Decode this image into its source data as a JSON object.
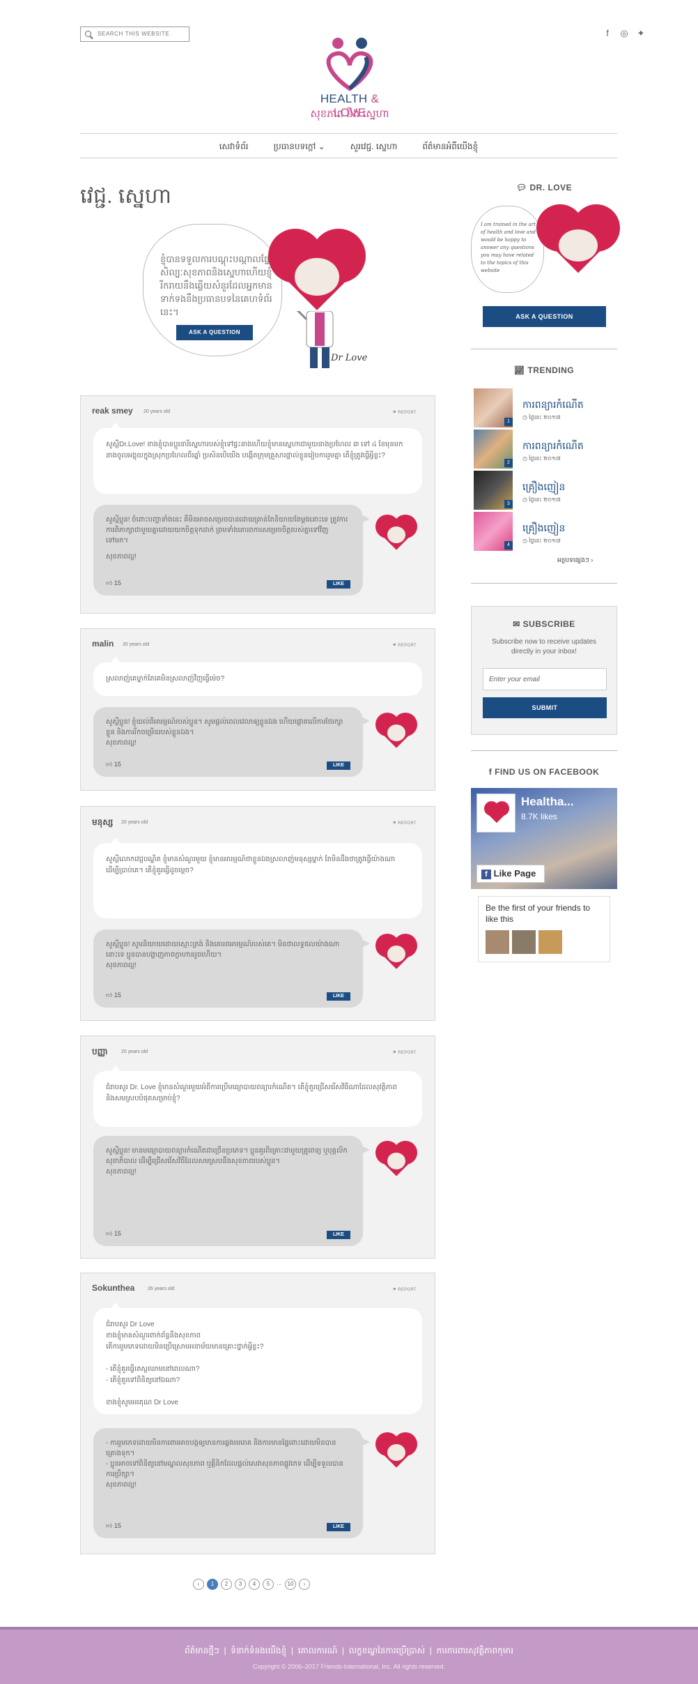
{
  "header": {
    "search_placeholder": "SEARCH THIS WEBSITE",
    "logo_title_a": "HEALTH",
    "logo_amp": "&",
    "logo_title_b": "LOVE",
    "logo_sub": "សុខភាព និង ស្នេហា",
    "social": [
      "facebook-icon",
      "instagram-icon",
      "twitter-icon"
    ]
  },
  "nav": {
    "items": [
      "សេវាទំព័រ",
      "ប្រធានបទក្តៅ",
      "សួរវេជ្ជ. ស្នេហា",
      "ព័ត៌មានអំពីយើងខ្ញុំ"
    ]
  },
  "page": {
    "title": "វេជ្ជ. ស្នេហា",
    "hero_text": "ខ្ញុំបានទទួលការបណ្តុះបណ្តាលផ្នែកសិល្បៈសុខភាពនិងស្នេហាហើយខ្ញុំរីករាយនឹងឆ្លើយសំនួរដែលអ្នកមានទាក់ទងនឹងប្រធានបទនៃគេហទំព័រនេះ។",
    "ask_label": "ASK A QUESTION",
    "signature": "Dr Love"
  },
  "questions": [
    {
      "name": "reak smey",
      "age": "20 years old",
      "report": "REPORT",
      "question": "សួស្តីDr.Love! ខាងខ្ញុំបានប្តូរនារីស្នេហារបស់ខ្ញុំទៅផ្ទះនាងហើយ​ខ្ញុំមានស្នេហាជាមួយនាងប្រហែល ៣ ទៅ ៤ ខែមុនមក នាងចូលអង្គុយក្នុងស្រុកប្រហែលពីរឆ្នាំ ប្រសិនបើយើង បង្កើតក្រុមគ្រួសារផ្ទាល់ខ្លួនរៀបការរួមគ្នា តើខ្ញុំត្រូវធ្វើអ្វីខ្លះ?",
      "answer": "សួស្តីប្អូន! ចំពោះបញ្ហាទាំងនេះ គឺមិនអាចសម្រេចបានដោយគ្រាន់តែនិយាយតែម្តងនោះទេ ត្រូវការការពិភាក្សាជាមួយគ្នាដោយយកចិត្តទុកដាក់ ព្រមទាំងគោរពការសម្រេចចិត្តរបស់គ្នាទៅវិញទៅមក។",
      "signoff": "សុខភាពល្អ!",
      "likes": "15"
    },
    {
      "name": "malin",
      "age": "20 years old",
      "report": "REPORT",
      "question": "ស្រលាញ់គេម្នាក់តែគេមិនស្រលាញ់វិញធ្វើម៉េច?",
      "answer": "សួស្តីប្អូន! ខ្ញុំយល់ពីអារម្មណ៍របស់ប្អូន។ សូមផ្តល់ពេលវេលាឲ្យខ្លួនឯង ហើយផ្តោតលើការថែរក្សាខ្លួន និងការរីកចម្រើនរបស់ខ្លួនឯង។",
      "signoff": "សុខភាពល្អ!",
      "likes": "15"
    },
    {
      "name": "មនុស្ស",
      "age": "20 years old",
      "report": "REPORT",
      "question": "សួស្តីលោកវេជ្ជបណ្ឌិត ខ្ញុំមានសំណួរមួយ ខ្ញុំមានអារម្មណ៍ថាខ្លួនឯងស្រលាញ់មនុស្សម្នាក់ តែមិនដឹងថាត្រូវធ្វើយ៉ាងណា ដើម្បីប្រាប់គេ។ តើខ្ញុំគួរធ្វើដូចម្តេច?",
      "answer": "សួស្តីប្អូន! សូមនិយាយដោយស្មោះត្រង់ និងគោរពអារម្មណ៍របស់គេ។ មិនថាលទ្ធផលយ៉ាងណានោះទេ ប្អូនបានបង្ហាញភាពក្លាហានរួចហើយ។",
      "signoff": "សុខភាពល្អ!",
      "likes": "15"
    },
    {
      "name": "បញ្ញា",
      "age": "20 years old",
      "report": "REPORT",
      "question": "ជំរាបសួរ Dr. Love ខ្ញុំមានសំណួរមួយអំពីការប្រើមធ្យោបាយពន្យារកំណើត។ តើខ្ញុំគួរជ្រើសរើសវិធីណាដែលសុវត្ថិភាព និងសមស្របបំផុតសម្រាប់ខ្ញុំ?",
      "answer": "សួស្តីប្អូន! មានមធ្យោបាយពន្យារកំណើតជាច្រើនប្រភេទ។ ប្អូនគួរពិគ្រោះជាមួយគ្រូពេទ្យ ឬបុគ្គលិកសុខាភិបាល ដើម្បីជ្រើសរើសវិធីដែលសមស្របនឹងសុខភាពរបស់ប្អូន។",
      "signoff": "សុខភាពល្អ!",
      "likes": "15"
    },
    {
      "name": "Sokunthea",
      "age": "26 years old",
      "report": "REPORT",
      "question": "ជំរាបសួរ Dr Love\nខាងខ្ញុំមានសំណួរពាក់ព័ន្ធនឹងសុខភាព\nតើការរួមភេទដោយមិនប្រើស្រោមអនាម័យមានគ្រោះថ្នាក់អ្វីខ្លះ?\n\n- តើខ្ញុំគួរធ្វើតេស្តឈាមនៅពេលណា?\n- តើខ្ញុំគួរទៅពិនិត្យនៅឯណា?\n\nខាងខ្ញុំសូមអរគុណ Dr Love",
      "answer": "- ការរួមភេទដោយមិនការពារអាចបង្កឲ្យមានការឆ្លងមេរោគ និងការមានផ្ទៃពោះដោយមិនបានគ្រោងទុក។\n- ប្អូនអាចទៅពិនិត្យនៅមណ្ឌលសុខភាព ឬគ្លីនិកដែលផ្តល់សេវាសុខភាពផ្លូវភេទ ដើម្បីទទួលបានការប្រឹក្សា។",
      "signoff": "សុខភាពល្អ!",
      "likes": "15"
    }
  ],
  "pagination": {
    "pages": [
      "1",
      "2",
      "3",
      "4",
      "5",
      "...",
      "10"
    ],
    "current": "1",
    "prev": "‹",
    "next": "›"
  },
  "sidebar": {
    "drlove_heading": "DR. LOVE",
    "drlove_text": "I am trained in the art of health and love and would be happy to answer any questions you may have related to the topics of this website",
    "ask_label": "ASK A QUESTION",
    "trending_heading": "TRENDING",
    "trending": [
      {
        "title": "ការពន្យារកំណើត",
        "date": "ថ្ងៃនេះ ២០១៧"
      },
      {
        "title": "ការពន្យារកំណើត",
        "date": "ថ្ងៃនេះ ២០១៧"
      },
      {
        "title": "គ្រឿងញៀន",
        "date": "ថ្ងៃនេះ ២០១៧"
      },
      {
        "title": "គ្រឿងញៀន",
        "date": "ថ្ងៃនេះ ២០១៧"
      }
    ],
    "trending_more": "អត្ថបទផ្សេងៗ",
    "subscribe_heading": "SUBSCRIBE",
    "subscribe_text": "Subscribe now to receive updates directly in your inbox!",
    "email_placeholder": "Enter your email",
    "subscribe_button": "SUBMIT",
    "facebook_heading": "FIND US ON FACEBOOK",
    "fb_page_name": "Healtha...",
    "fb_likes": "8.7K likes",
    "fb_like_page": "Like Page",
    "fb_friends_text": "Be the first of your friends to like this"
  },
  "footer": {
    "links": [
      "ព័ត៌មានថ្មីៗ",
      "ទំនាក់ទំនងយើងខ្ញុំ",
      "គោលការណ៍",
      "លក្ខខណ្ឌនៃការប្រើប្រាស់",
      "ការការពារសុវត្ថិភាពកុមារ"
    ],
    "copyright": "Copyright © 2006–2017 Friends-International, Inc. All rights reserved."
  },
  "colors": {
    "brand_blue": "#1b4d82",
    "heart_red": "#d3244f",
    "footer_purple": "#c39bc6",
    "logo_pink": "#c6488a"
  }
}
